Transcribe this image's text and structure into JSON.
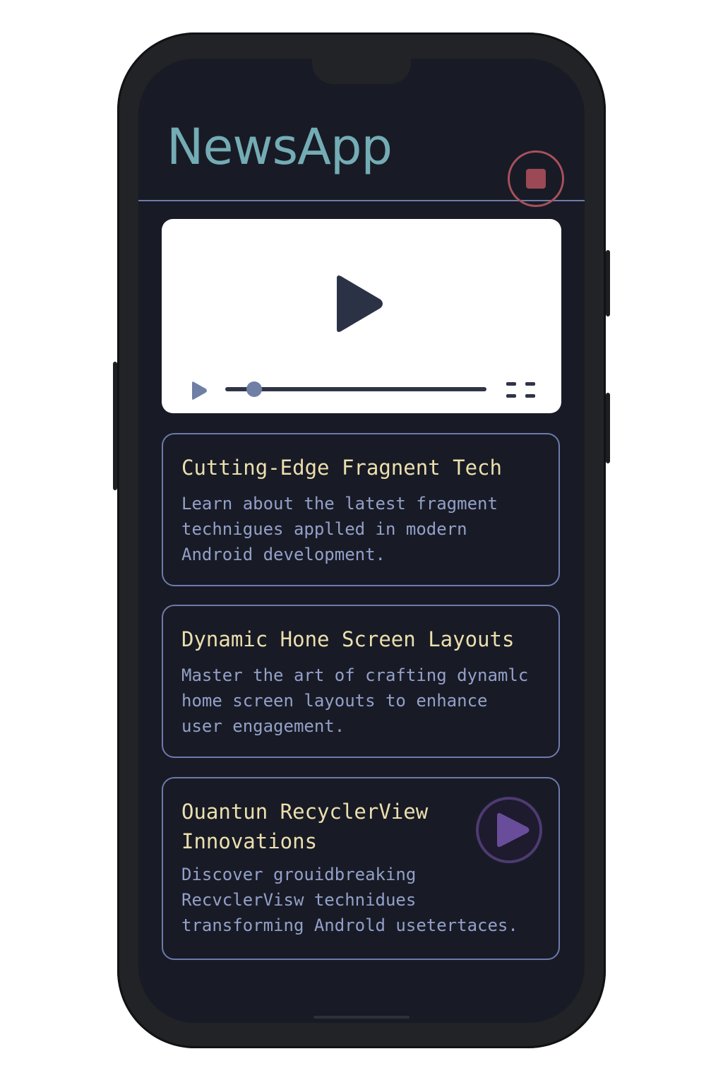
{
  "header": {
    "title": "NewsApp",
    "stop_icon": "stop-icon"
  },
  "video_player": {
    "play_icon": "play-icon",
    "progress": 0.11,
    "fullscreen_icon": "fullscreen-icon"
  },
  "articles": [
    {
      "title": "Cutting-Edge Fragnent Tech",
      "description": "Learn about the latest fragment\ntechnigues applled in modern\nAndroid development."
    },
    {
      "title": "Dynamic Hone Screen Layouts",
      "description": "Master the art of crafting dynamlc\nhome screen layouts to enhance\nuser engagement."
    },
    {
      "title": "Ouantun RecyclerView\nInnovations",
      "description": "Discover grouidbreaking\nRecvclerVisw technidues\ntransforming Androld usetertaces.",
      "icon": "play-circle-icon"
    }
  ],
  "colors": {
    "background": "#181b25",
    "accent_title": "#74acb5",
    "card_title": "#ecdfae",
    "card_text": "#93a0c9",
    "card_border": "#6e7aad",
    "stop": "#a8505b",
    "play_circle": "#4e3a72"
  }
}
